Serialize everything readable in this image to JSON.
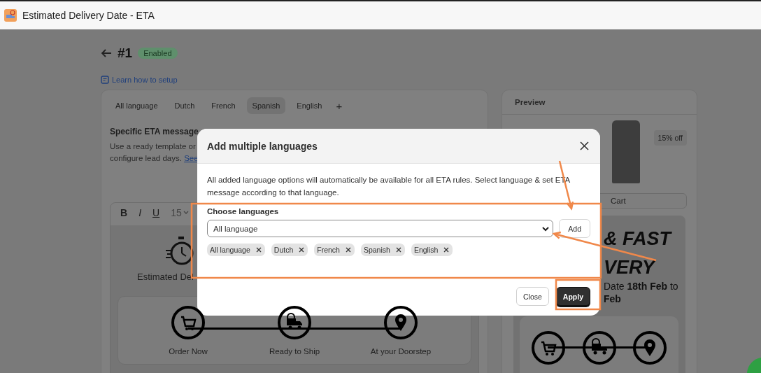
{
  "window": {
    "title": "Estimated Delivery Date - ETA"
  },
  "header": {
    "title": "#1",
    "status": "Enabled"
  },
  "help_link": "Learn how to setup",
  "editor_card": {
    "tabs": [
      {
        "label": "All language",
        "selected": false
      },
      {
        "label": "Dutch",
        "selected": false
      },
      {
        "label": "French",
        "selected": false
      },
      {
        "label": "Spanish",
        "selected": true
      },
      {
        "label": "English",
        "selected": false
      }
    ],
    "add_tab": "+",
    "section_title": "Specific ETA message",
    "description_lines": [
      "Use a ready template or",
      "configure lead days."
    ],
    "description_link": "See",
    "toolbar": {
      "bold": "B",
      "italic": "I",
      "underline": "U",
      "font_size": "15"
    },
    "widget_title": "Estimated Del",
    "steps": [
      {
        "kind": "cart",
        "label": "Order Now"
      },
      {
        "kind": "truck",
        "label": "Ready to Ship"
      },
      {
        "kind": "pin",
        "label": "At your Doorstep"
      }
    ]
  },
  "preview": {
    "title": "Preview",
    "discount_badge": "15% off",
    "cart_button": "Cart",
    "headline_lines": [
      "& FAST",
      "VERY"
    ],
    "date_line": "Date **18th Feb** to",
    "date_line_2": "Feb",
    "steps": [
      {
        "kind": "cart"
      },
      {
        "kind": "truck"
      },
      {
        "kind": "pin"
      }
    ]
  },
  "modal": {
    "title": "Add multiple languages",
    "description": "All added language options will automatically be available for all ETA rules. Select language & set ETA message according to that language.",
    "field_label": "Choose languages",
    "select_value": "All language",
    "add_button": "Add",
    "chips": [
      "All language",
      "Dutch",
      "French",
      "Spanish",
      "English"
    ],
    "buttons": [
      {
        "label": "Close",
        "kind": "secondary"
      },
      {
        "label": "Apply",
        "kind": "primary"
      }
    ]
  },
  "annotations": [
    {
      "kind": "frame"
    },
    {
      "kind": "frame"
    },
    {
      "kind": "arrow"
    },
    {
      "kind": "arrow"
    }
  ]
}
